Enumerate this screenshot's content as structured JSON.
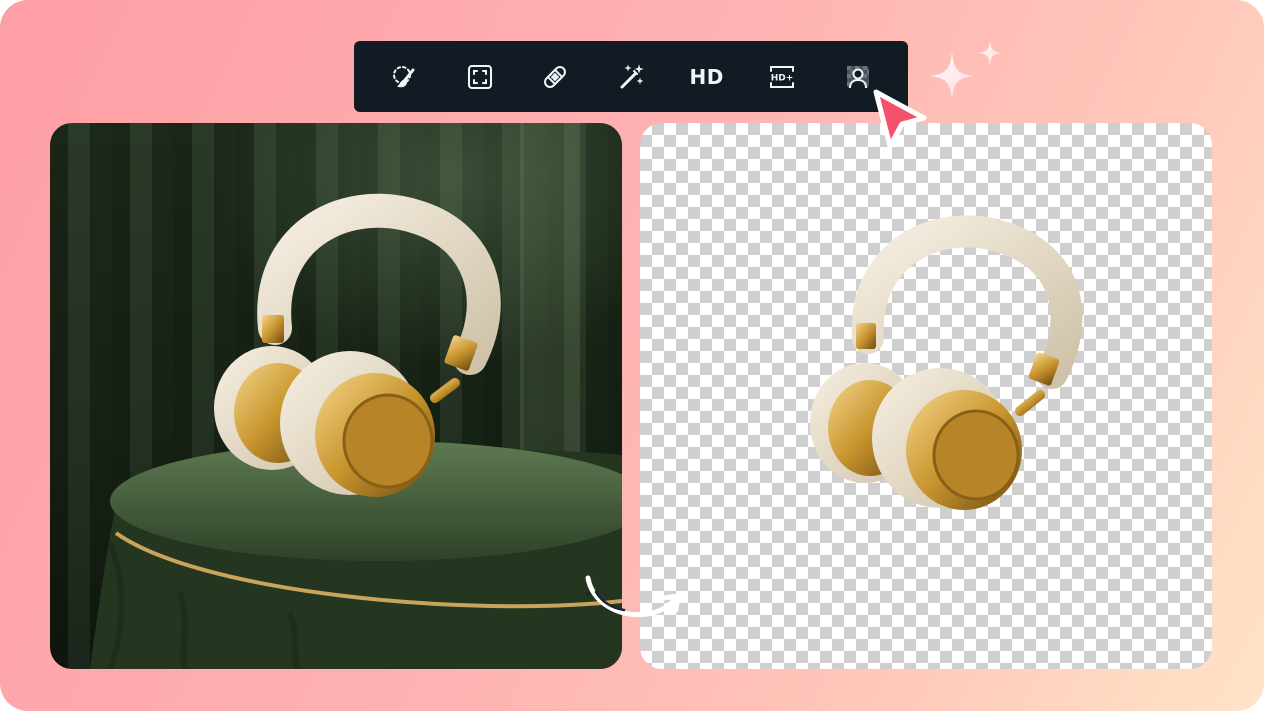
{
  "toolbar": {
    "tools": [
      {
        "icon": "lasso-brush-icon"
      },
      {
        "icon": "crop-frame-icon"
      },
      {
        "icon": "bandage-heal-icon"
      },
      {
        "icon": "magic-wand-icon"
      },
      {
        "icon": "hd-text-icon",
        "label": "HD"
      },
      {
        "icon": "hd-plus-icon",
        "label": "HD+"
      },
      {
        "icon": "portrait-cutout-icon"
      }
    ]
  },
  "panels": {
    "original": {
      "subject": "gold-cream-headphones-on-green-velvet-table"
    },
    "result": {
      "subject": "gold-cream-headphones-transparent-background"
    }
  },
  "colors": {
    "toolbar_bg": "#121a24",
    "cursor": "#f5516a",
    "gradient_start": "#fe9ea5",
    "gradient_end": "#ffe4c8"
  }
}
